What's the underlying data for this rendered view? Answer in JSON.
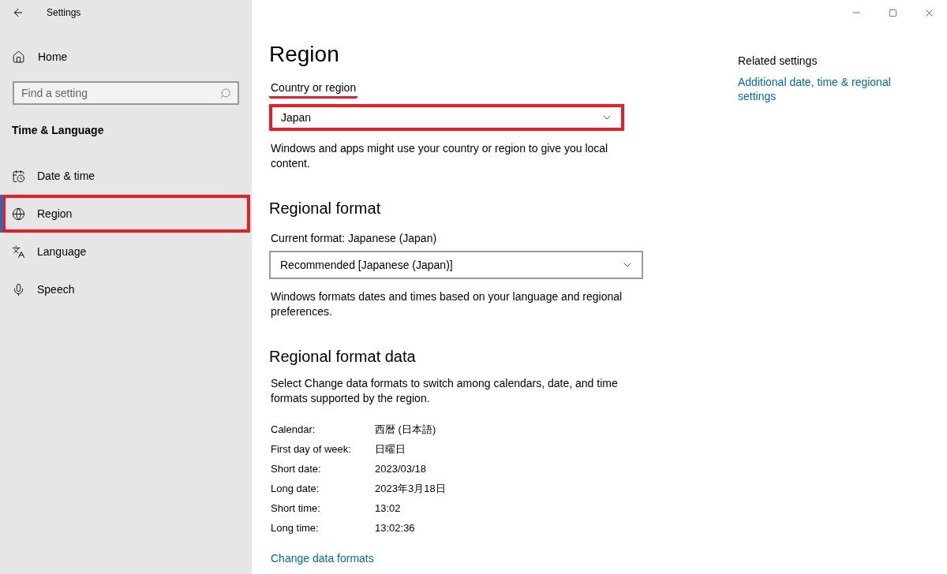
{
  "window": {
    "title": "Settings"
  },
  "sidebar": {
    "home": "Home",
    "search": {
      "placeholder": "Find a setting"
    },
    "section": "Time & Language",
    "items": [
      {
        "label": "Date & time",
        "kind": "calendar",
        "selected": false,
        "highlighted": false
      },
      {
        "label": "Region",
        "kind": "globe",
        "selected": true,
        "highlighted": true
      },
      {
        "label": "Language",
        "kind": "language",
        "selected": false,
        "highlighted": false
      },
      {
        "label": "Speech",
        "kind": "mic",
        "selected": false,
        "highlighted": false
      }
    ]
  },
  "page": {
    "title": "Region",
    "country": {
      "label": "Country or region",
      "underlined": true,
      "value": "Japan",
      "highlighted": true,
      "note": "Windows and apps might use your country or region to give you local content."
    },
    "regional_format": {
      "heading": "Regional format",
      "current": "Current format: Japanese (Japan)",
      "value": "Recommended [Japanese (Japan)]",
      "highlighted": false,
      "note": "Windows formats dates and times based on your language and regional preferences."
    },
    "format_data": {
      "heading": "Regional format data",
      "note": "Select Change data formats to switch among calendars, date, and time formats supported by the region.",
      "rows": [
        {
          "label": "Calendar:",
          "value": "西暦 (日本語)"
        },
        {
          "label": "First day of week:",
          "value": "日曜日"
        },
        {
          "label": "Short date:",
          "value": "2023/03/18"
        },
        {
          "label": "Long date:",
          "value": "2023年3月18日"
        },
        {
          "label": "Short time:",
          "value": "13:02"
        },
        {
          "label": "Long time:",
          "value": "13:02:36"
        }
      ],
      "link": "Change data formats"
    }
  },
  "related": {
    "heading": "Related settings",
    "link": "Additional date, time & regional settings"
  }
}
